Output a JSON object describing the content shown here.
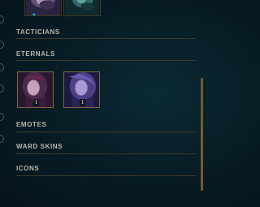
{
  "top_row": {
    "items": [
      {
        "icon": "champion-portrait"
      },
      {
        "icon": "champion-portrait"
      }
    ],
    "selected_marker": "▲"
  },
  "sections": {
    "tacticians": {
      "title": "TACTICIANS"
    },
    "eternals": {
      "title": "ETERNALS",
      "items": [
        {
          "icon": "eternal-portrait",
          "count": "1"
        },
        {
          "icon": "eternal-portrait",
          "count": "1"
        }
      ]
    },
    "emotes": {
      "title": "EMOTES"
    },
    "ward_skins": {
      "title": "WARD SKINS"
    },
    "icons": {
      "title": "ICONS"
    }
  },
  "colors": {
    "accent_gold": "#c8aa6e",
    "accent_blue": "#0ac8e8",
    "scrollbar": "#785a28"
  }
}
